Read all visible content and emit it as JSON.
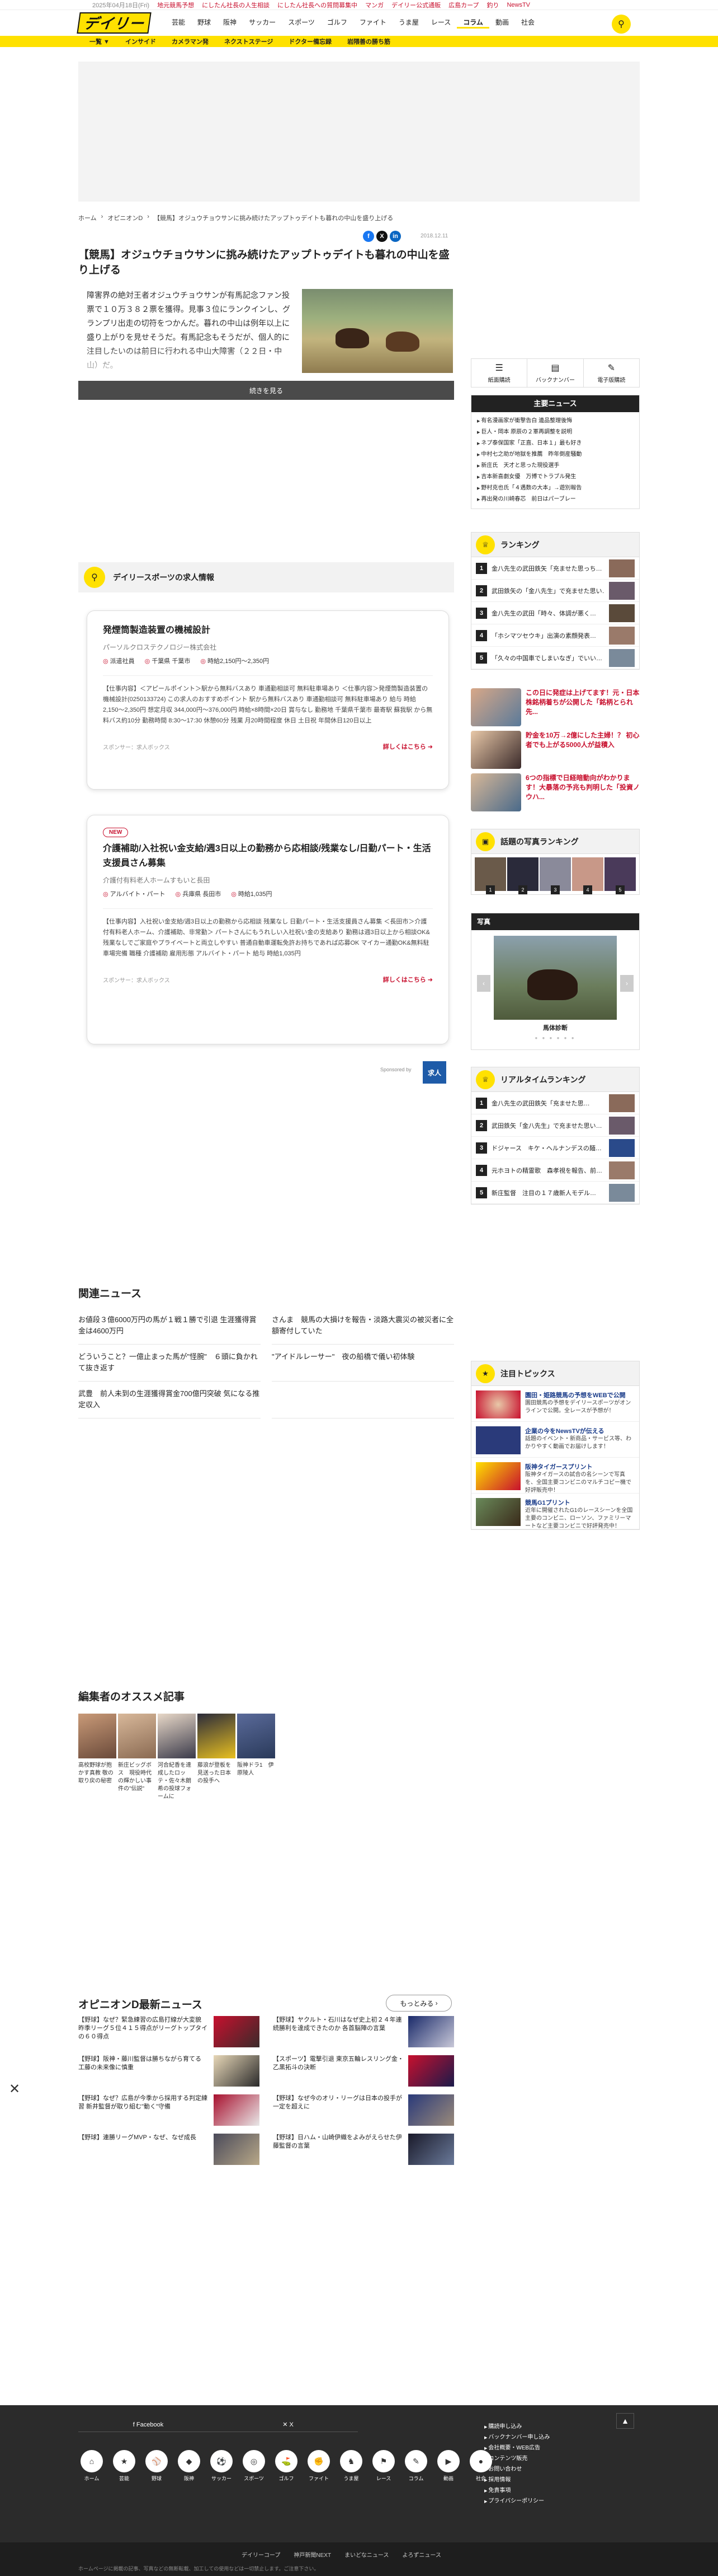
{
  "topbar": {
    "date": "2025年04月18日(Fri)",
    "links": [
      "地元競馬予想",
      "にしたん社長の人生相談",
      "にしたん社長への質問募集中",
      "マンガ",
      "デイリー公式通販",
      "広島カープ",
      "釣り",
      "NewsTV"
    ]
  },
  "header": {
    "logo": "デイリー",
    "nav": [
      "芸能",
      "野球",
      "阪神",
      "サッカー",
      "スポーツ",
      "ゴルフ",
      "ファイト",
      "うま屋",
      "レース",
      "コラム",
      "動画",
      "社会"
    ],
    "active": "コラム"
  },
  "subnav": [
    "一覧 ▼",
    "インサイド",
    "カメラマン発",
    "ネクストステージ",
    "ドクター備忘録",
    "岩隈善の勝ち筋"
  ],
  "breadcrumb": [
    "ホーム",
    "オピニオンD",
    "【競馬】オジュウチョウサンに挑み続けたアップトゥデイトも暮れの中山を盛り上げる"
  ],
  "article": {
    "date": "2018.12.11",
    "title": "【競馬】オジュウチョウサンに挑み続けたアップトゥデイトも暮れの中山を盛り上げる",
    "lead": "障害界の絶対王者オジュウチョウサンが有馬記念ファン投票で１０万３８２票を獲得。見事３位にランクインし、グランプリ出走の切符をつかんだ。暮れの中山は例年以上に盛り上がりを見せそうだ。有馬記念もそうだが、個人的に注目したいのは前日に行われる中山大障害（２２日・中山）だ。",
    "read_more": "続きを見る"
  },
  "share_icons": [
    "f",
    "X",
    "in"
  ],
  "jobs": {
    "heading": "デイリースポーツの求人情報",
    "items": [
      {
        "title": "発煙筒製造装置の機械設計",
        "company": "パーソルクロステクノロジー株式会社",
        "meta": [
          "派遣社員",
          "千葉県 千葉市",
          "時給2,150円〜2,350円"
        ],
        "desc": "【仕事内容】＜アピールポイント＞駅から無料バスあり 車通勤相談可 無料駐車場あり ＜仕事内容＞発煙筒製造装置の機械設計(0250133724) この求人のおすすめポイント 駅から無料バスあり 車通勤相談可 無料駐車場あり 給与 時給2,150〜2,350円 想定月収 344,000円〜376,000円 時給×8時間×20日 賞与なし 勤務地 千葉県千葉市 最寄駅 蘇我駅 から無料バス約10分 勤務時間 8:30〜17:30 休憩60分 残業 月20時間程度 休日 土日祝 年間休日120日以上",
        "sponsor": "スポンサー：求人ボックス",
        "more": "詳しくはこちら"
      },
      {
        "badge": "NEW",
        "title": "介護補助/入社祝い金支給/週3日以上の勤務から応相談/残業なし/日勤パート・生活支援員さん募集",
        "company": "介護付有料老人ホームすもいと長田",
        "meta": [
          "アルバイト・パート",
          "兵庫県 長田市",
          "時給1,035円"
        ],
        "desc": "【仕事内容】入社祝い金支給/週3日以上の勤務から応相談 残業なし 日勤パート・生活支援員さん募集 ＜長田市＞介護付有料老人ホーム、介護補助、非常勤＞ パートさんにもうれしい入社祝い金の支給あり 勤務は週3日以上から相談OK&残業なしでご家庭やプライベートと両立しやすい 普通自動車運転免許お持ちであれば応募OK マイカー通勤OK&無料駐車場完備 職種 介護補助 雇用形態 アルバイト・パート 給与 時給1,035円",
        "sponsor": "スポンサー：求人ボックス",
        "more": "詳しくはこちら"
      }
    ],
    "sponsored_by": "Sponsored by",
    "kyujin_logo": "求人"
  },
  "related": {
    "heading": "関連ニュース",
    "items": [
      "お値段３億6000万円の馬が１戦１勝で引退 生涯獲得賞金は4600万円",
      "さんま　競馬の大損けを報告・淡路大震災の被災者に全額寄付していた",
      "どういうこと？一億止まった馬が\"怪腕\"　６頭に負かれて抜き返す",
      "\"アイドルレーサー\"　夜の船橋で儀い初体験",
      "武豊　前人未到の生涯獲得賞金700億円突破 気になる推定収入",
      ""
    ]
  },
  "osusume": {
    "heading": "編集者のオススメ記事",
    "items": [
      "高校野球が抱かす真教 敬の取り戻の秘密",
      "新庄ビッグボス　現役時代の輝かしい事件の\"伝説\"",
      "河合紀香を達成したロッテ・佐々木朗希の投球フォームに",
      "藤浪が登板を見送った日本の投手へ",
      "阪神ドラ1　伊原陵人"
    ]
  },
  "op_news": {
    "heading": "オピニオンD最新ニュース",
    "more": "もっとみる",
    "items": [
      "【野球】なぜ？緊急練習の広島打線が大変貌 昨季リーグ５位４１５得点がリーグトップタイの６０得点",
      "【野球】ヤクルト・石川はなぜ史上初２４年連続勝利を達成できたのか 各首脳陣の言葉",
      "【野球】阪神・藤川監督は勝ちながら育てる 工藤の未来像に慎重",
      "【スポーツ】電撃引退 東京五輪レスリング金・乙黒拓斗の決断",
      "【野球】なぜ？広島が今季から採用する判定練習 新井監督が取り組む\"動く\"守備",
      "【野球】なぜ今のオリ・リーグは日本の投手が一定を超えに",
      "【野球】連勝リーグMVP・なぜ、なぜ成長",
      "【野球】日ハム・山崎伊織をよみがえらせた伊藤監督の言葉"
    ]
  },
  "sidebar": {
    "tools": [
      "紙面購読",
      "バックナンバー",
      "電子版購読"
    ],
    "main_news": {
      "heading": "主要ニュース",
      "items": [
        "有名漫画家が衝撃告白 遺品整理後悔",
        "巨人・岡本 原辰の２軍再調整を説明",
        "ネプ泰保国家「正直、日本１」最も好き",
        "中村七之助が地獄を推薦　昨年倒産騒動",
        "新庄氏　天才と思った現役選手",
        "吉本新喜劇女優　万博でトラブル発生",
        "野村克也氏「４遇数の大本」→遊別報告",
        "再出発の川崎春芯　前日はパーブレー"
      ]
    },
    "ranking": {
      "heading": "ランキング",
      "items": [
        "金八先生の武田鉄矢「充ませた思っち…",
        "武田鉄矢の「金八先生」で充ませた思い…",
        "金八先生の武田「時々、体調が悪く…",
        "「ホシマツセウキ」出演の素顔発表…",
        "「久々の中国車でしまいなぎ」でいい…"
      ]
    },
    "ads": [
      "この日に発症は上げてます！元・日本株銘柄着ちが公開した「銘柄とられ先...",
      "貯金を10万→2億にした主婦！？ 初心者でも上がる5000人が益積入",
      "6つの指標で日経暗動向がわかります！大暴落の予兆も判明した「投資ノウハ..."
    ],
    "photo_rank": {
      "heading": "話題の写真ランキング",
      "nums": [
        "1",
        "2",
        "3",
        "4",
        "5"
      ]
    },
    "photo": {
      "heading": "写真",
      "caption": "馬体診断"
    },
    "realtime": {
      "heading": "リアルタイムランキング",
      "items": [
        "金八先生の武田鉄矢「充ませた思…",
        "武田鉄矢「金八先生」で充ませた思い…",
        "ドジャース　キケ・ヘルナンデスの麺…",
        "元ホヨトの精霊歌　森孝視を報告、前…",
        "新庄監督　注目の１７歳新人モデル…"
      ]
    },
    "topics": {
      "heading": "注目トピックス",
      "items": [
        {
          "title": "園田・姫路競馬の予想をWEBで公開",
          "desc": "園田競馬の予想をデイリースポーツがオンラインで公開。全レースが予想が！"
        },
        {
          "title": "企業の今をNewsTVが伝える",
          "desc": "話題のイベント・新商品・サービス等、わかりやすく動画でお届けします！"
        },
        {
          "title": "阪神タイガースプリント",
          "desc": "阪神タイガースの試合の名シーンで写真を、全国主要コンビニのマルチコピー機で好評販売中！"
        },
        {
          "title": "競馬G1プリント",
          "desc": "近年に開催されたG1のレースシーンを全国主要のコンビニ、ローソン、ファミリーマートなど主要コンビニで好評発売中！"
        }
      ]
    }
  },
  "footer": {
    "social": [
      "Facebook",
      "X"
    ],
    "icons": [
      "ホーム",
      "芸能",
      "野球",
      "阪神",
      "サッカー",
      "スポーツ",
      "ゴルフ",
      "ファイト",
      "うま屋",
      "レース",
      "コラム",
      "動画",
      "社会"
    ],
    "links": [
      "購読申し込み",
      "バックナンバー申し込み",
      "会社概要・WEB広告",
      "コンテンツ販売",
      "お問い合わせ",
      "採用情報",
      "免責事項",
      "プライバシーポリシー"
    ],
    "bottom_links": [
      "デイリーコープ",
      "神戸新聞NEXT",
      "まいどなニュース",
      "よろずニュース"
    ],
    "copyright": "ホームページに掲載の記事、写真などの無断転載、加工しての使用などは一切禁止します。ご注意下さい。"
  }
}
